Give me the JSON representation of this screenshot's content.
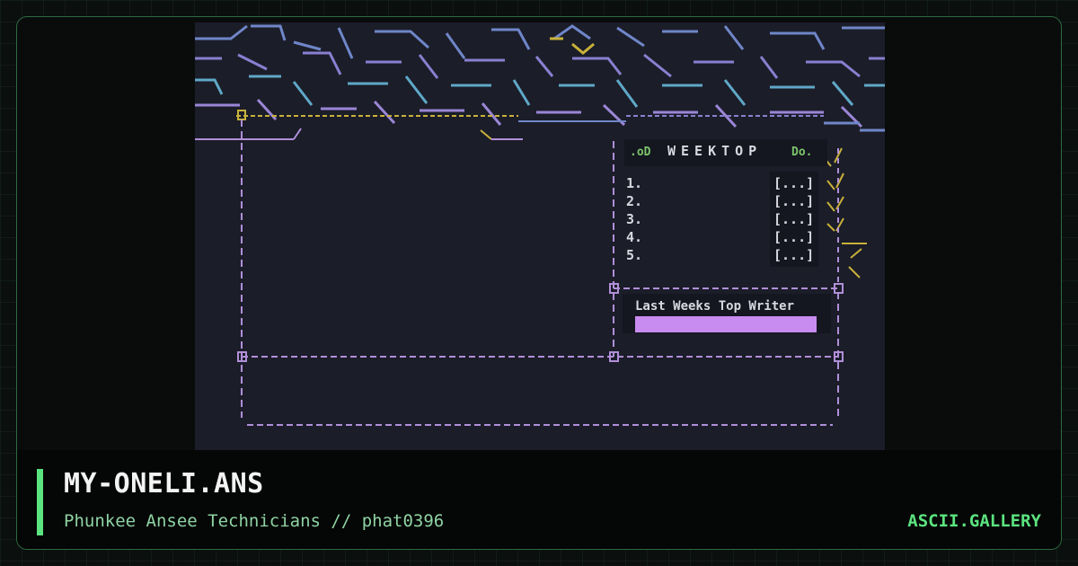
{
  "artwork": {
    "panel_header": "WEEKTOP",
    "list_items": [
      {
        "num": "1.",
        "value": "[...]"
      },
      {
        "num": "2.",
        "value": "[...]"
      },
      {
        "num": "3.",
        "value": "[...]"
      },
      {
        "num": "4.",
        "value": "[...]"
      },
      {
        "num": "5.",
        "value": "[...]"
      }
    ],
    "top_writer_label": "Last Weeks Top Writer",
    "colors": {
      "background": "#1b1d29",
      "frame_lines": "#b08fd8",
      "accent_yellow": "#c9b23a",
      "highlight": "#c88cf0",
      "logo_blue": "#6f86c8",
      "text": "#d8d8e0"
    }
  },
  "footer": {
    "title": "MY-ONELI.ANS",
    "subtitle": "Phunkee Ansee Technicians // phat0396",
    "brand": "ASCII.GALLERY",
    "accent_color": "#5be37f"
  }
}
